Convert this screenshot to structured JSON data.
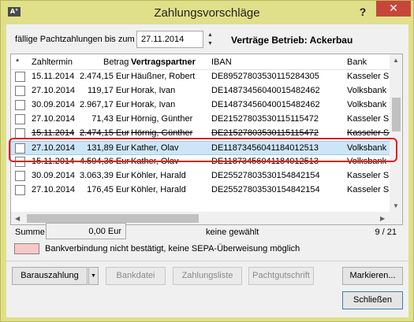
{
  "window": {
    "title": "Zahlungsvorschläge",
    "app_icon": "A°",
    "help_label": "?",
    "close_label": "✕"
  },
  "filter": {
    "due_label": "fällige Pachtzahlungen bis zum",
    "due_date": "27.11.2014",
    "contracts_label": "Verträge Betrieb: Ackerbau"
  },
  "grid": {
    "columns": [
      "*",
      "Zahltermin",
      "Betrag",
      "Vertragspartner",
      "IBAN",
      "Bank"
    ],
    "rows": [
      {
        "date": "15.11.2014",
        "amount": "2.474,15 Eur",
        "partner": "Häußner, Robert",
        "iban": "DE89527803530115284305",
        "bank": "Kasseler Spa",
        "strike": false
      },
      {
        "date": "27.10.2014",
        "amount": "119,17 Eur",
        "partner": "Horak, Ivan",
        "iban": "DE14873456040015482462",
        "bank": "Volksbank Li",
        "strike": false
      },
      {
        "date": "30.09.2014",
        "amount": "2.967,17 Eur",
        "partner": "Horak, Ivan",
        "iban": "DE14873456040015482462",
        "bank": "Volksbank Li",
        "strike": false
      },
      {
        "date": "27.10.2014",
        "amount": "71,43 Eur",
        "partner": "Hörnig, Günther",
        "iban": "DE21527803530115115472",
        "bank": "Kasseler Spa",
        "strike": false
      },
      {
        "date": "15.11.2014",
        "amount": "2.474,15 Eur",
        "partner": "Hörnig, Günther",
        "iban": "DE21527803530115115472",
        "bank": "Kasseler Spa",
        "strike": true
      },
      {
        "date": "27.10.2014",
        "amount": "131,89 Eur",
        "partner": "Kather, Olav",
        "iban": "DE11873456041184012513",
        "bank": "Volksbank Li",
        "strike": false,
        "selected": true
      },
      {
        "date": "15.11.2014",
        "amount": "4.594,36 Eur",
        "partner": "Kather, Olav",
        "iban": "DE11873456041184012513",
        "bank": "Volksbank Li",
        "strike": true
      },
      {
        "date": "30.09.2014",
        "amount": "3.063,39 Eur",
        "partner": "Köhler, Harald",
        "iban": "DE25527803530154842154",
        "bank": "Kasseler Spa",
        "strike": false
      },
      {
        "date": "27.10.2014",
        "amount": "176,45 Eur",
        "partner": "Köhler, Harald",
        "iban": "DE25527803530154842154",
        "bank": "Kasseler Spa",
        "strike": false
      }
    ]
  },
  "summary": {
    "sum_label": "Summe",
    "sum_value": "0,00 Eur",
    "selection_status": "keine gewählt",
    "count": "9 / 21",
    "legend_text": "Bankverbindung nicht bestätigt, keine SEPA-Überweisung möglich",
    "legend_color": "#f8c8c8"
  },
  "buttons": {
    "cash": "Barauszahlung",
    "dropdown": "▼",
    "bankfile": "Bankdatei",
    "paylist": "Zahlungsliste",
    "credit": "Pachtgutschrift",
    "mark": "Markieren...",
    "close": "Schließen"
  }
}
